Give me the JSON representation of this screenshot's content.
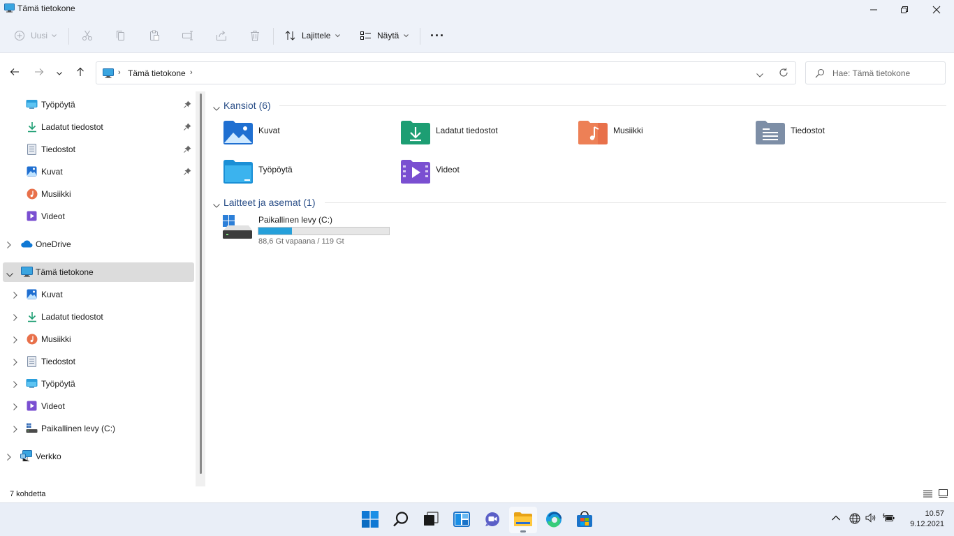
{
  "window": {
    "title": "Tämä tietokone"
  },
  "toolbar": {
    "new_label": "Uusi",
    "sort_label": "Lajittele",
    "view_label": "Näytä",
    "more_label": "···"
  },
  "address": {
    "crumb": "Tämä tietokone",
    "separator": "›"
  },
  "search": {
    "placeholder": "Hae: Tämä tietokone"
  },
  "sidebar": {
    "quick_access": [
      {
        "label": "Työpöytä",
        "icon": "desktop-folder-icon",
        "pinned": true
      },
      {
        "label": "Ladatut tiedostot",
        "icon": "download-icon",
        "pinned": true
      },
      {
        "label": "Tiedostot",
        "icon": "documents-icon",
        "pinned": true
      },
      {
        "label": "Kuvat",
        "icon": "pictures-icon",
        "pinned": true
      },
      {
        "label": "Musiikki",
        "icon": "music-icon",
        "pinned": false
      },
      {
        "label": "Videot",
        "icon": "videos-icon",
        "pinned": false
      }
    ],
    "onedrive": {
      "label": "OneDrive",
      "icon": "onedrive-cloud-icon"
    },
    "this_pc": {
      "label": "Tämä tietokone",
      "icon": "computer-icon",
      "children": [
        {
          "label": "Kuvat",
          "icon": "pictures-icon"
        },
        {
          "label": "Ladatut tiedostot",
          "icon": "download-icon"
        },
        {
          "label": "Musiikki",
          "icon": "music-icon"
        },
        {
          "label": "Tiedostot",
          "icon": "documents-icon"
        },
        {
          "label": "Työpöytä",
          "icon": "desktop-folder-icon"
        },
        {
          "label": "Videot",
          "icon": "videos-icon"
        },
        {
          "label": "Paikallinen levy (C:)",
          "icon": "drive-icon"
        }
      ]
    },
    "network": {
      "label": "Verkko",
      "icon": "network-icon"
    }
  },
  "content": {
    "folders_header": "Kansiot (6)",
    "folders": [
      {
        "label": "Kuvat",
        "icon": "pictures-folder-icon",
        "color": "#1f6fd1"
      },
      {
        "label": "Ladatut tiedostot",
        "icon": "downloads-folder-icon",
        "color": "#1d9e73"
      },
      {
        "label": "Musiikki",
        "icon": "music-folder-icon",
        "color": "#e8704a"
      },
      {
        "label": "Tiedostot",
        "icon": "documents-folder-icon",
        "color": "#7d8ea6"
      },
      {
        "label": "Työpöytä",
        "icon": "desktop-folder-icon",
        "color": "#1a8fd6"
      },
      {
        "label": "Videot",
        "icon": "videos-folder-icon",
        "color": "#7a4fd1"
      }
    ],
    "devices_header": "Laitteet ja asemat (1)",
    "drive": {
      "name": "Paikallinen levy (C:)",
      "free_text": "88,6 Gt vapaana / 119 Gt",
      "used_fraction": 0.255,
      "bar_color": "#26a0da"
    }
  },
  "status": {
    "item_count": "7 kohdetta"
  },
  "taskbar": {
    "apps": [
      "windows-start-icon",
      "search-icon",
      "task-view-icon",
      "widgets-icon",
      "teams-chat-icon",
      "file-explorer-icon",
      "edge-icon",
      "store-icon"
    ],
    "active_app": "file-explorer-icon",
    "time": "10.57",
    "date": "9.12.2021"
  }
}
